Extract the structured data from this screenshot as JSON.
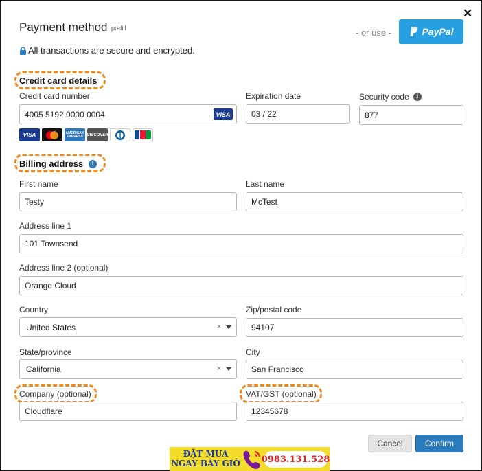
{
  "header": {
    "title": "Payment method",
    "prefill": "prefill",
    "or_use": "- or use -",
    "paypal_label": "PayPal",
    "secure_text": "All transactions are secure and encrypted."
  },
  "credit_card": {
    "section_title": "Credit card details",
    "number_label": "Credit card number",
    "number_value": "4005 5192 0000 0004",
    "number_brand": "VISA",
    "expiration_label": "Expiration date",
    "expiration_value": "03 / 22",
    "security_label": "Security code",
    "security_value": "877",
    "accepted_cards": [
      {
        "name": "VISA",
        "color": "#1a3a8f"
      },
      {
        "name": "mastercard",
        "color": "#111111"
      },
      {
        "name": "AMERICAN EXPRESS",
        "color": "#2e77bb"
      },
      {
        "name": "DISCOVER",
        "color": "#555555"
      },
      {
        "name": "Diners",
        "color": "#0c5fa6"
      },
      {
        "name": "JCB",
        "color": "#ffffff"
      }
    ]
  },
  "billing": {
    "section_title": "Billing address",
    "first_name_label": "First name",
    "first_name_value": "Testy",
    "last_name_label": "Last name",
    "last_name_value": "McTest",
    "address1_label": "Address line 1",
    "address1_value": "101 Townsend",
    "address2_label": "Address line 2 (optional)",
    "address2_value": "Orange Cloud",
    "country_label": "Country",
    "country_value": "United States",
    "zip_label": "Zip/postal code",
    "zip_value": "94107",
    "state_label": "State/province",
    "state_value": "California",
    "city_label": "City",
    "city_value": "San Francisco",
    "company_label": "Company (optional)",
    "company_value": "Cloudflare",
    "vat_label": "VAT/GST (optional)",
    "vat_value": "12345678",
    "clear_glyph": "×"
  },
  "actions": {
    "cancel": "Cancel",
    "confirm": "Confirm"
  },
  "banner": {
    "line1": "ĐẶT MUA",
    "line2": "NGAY BÂY GIỜ",
    "phone": "0983.131.528"
  },
  "colors": {
    "accent": "#2a7cbf",
    "paypal": "#27a0e2",
    "highlight": "#f08a1c"
  }
}
